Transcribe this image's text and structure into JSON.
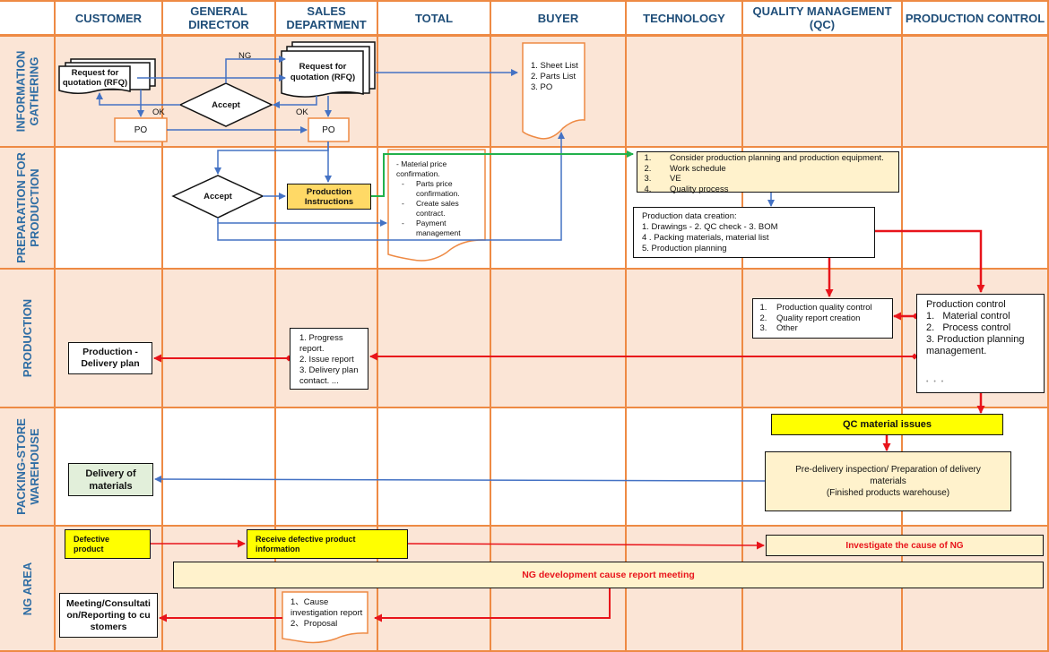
{
  "columns": [
    {
      "id": "customer",
      "label": "CUSTOMER"
    },
    {
      "id": "general-director",
      "label": "GENERAL\nDIRECTOR"
    },
    {
      "id": "sales-department",
      "label": "SALES\nDEPARTMENT"
    },
    {
      "id": "total",
      "label": "TOTAL"
    },
    {
      "id": "buyer",
      "label": "BUYER"
    },
    {
      "id": "technology",
      "label": "TECHNOLOGY"
    },
    {
      "id": "quality-management",
      "label": "QUALITY MANAGEMENT\n(QC)"
    },
    {
      "id": "production-control",
      "label": "PRODUCTION CONTROL"
    }
  ],
  "rows": [
    {
      "id": "information-gathering",
      "label": "INFORMATION\nGATHERING"
    },
    {
      "id": "preparation-for-production",
      "label": "PREPARATION FOR\nPRODUCTION"
    },
    {
      "id": "production",
      "label": "PRODUCTION"
    },
    {
      "id": "packing-store-warehouse",
      "label": "PACKING-STORE\nWAREHOUSE"
    },
    {
      "id": "ng-area",
      "label": "NG AREA"
    }
  ],
  "nodes": {
    "rfq_customer": "Request for quotation (RFQ)",
    "rfq_sales": "Request for quotation (RFQ)",
    "accept_gd": "Accept",
    "po_customer": "PO",
    "po_sales": "PO",
    "label_ng": "NG",
    "label_ok_left": "OK",
    "label_ok_right": "OK",
    "buyer_doc": [
      "1. Sheet List",
      "2. Parts List",
      "3. PO"
    ],
    "accept_prep": "Accept",
    "production_instructions": "Production Instructions",
    "total_doc": {
      "intro": "- Material price confirmation.",
      "items": [
        "Parts price confirmation.",
        "Create sales contract.",
        "Payment management"
      ]
    },
    "tech_plan": [
      "Consider production planning and production equipment.",
      "Work schedule",
      "VE",
      "Quality process"
    ],
    "production_data": [
      "Production data creation:",
      "1. Drawings -  2. QC check -  3. BOM",
      "4 . Packing materials, material list",
      "5. Production planning"
    ],
    "qc_production": [
      "Production quality control",
      "Quality report creation",
      "Other"
    ],
    "production_control": {
      "title": "Production control",
      "items": [
        "1.   Material control",
        "2.   Process control",
        "3. Production planning management."
      ],
      "ellipsis": "• • •"
    },
    "sales_reports": [
      "1. Progress report.",
      "2. Issue report",
      "3. Delivery plan contact. ..."
    ],
    "production_delivery_plan": "Production - Delivery plan",
    "qc_material_issues": "QC material issues",
    "pre_delivery": [
      "Pre-delivery inspection/ Preparation of delivery materials",
      "(Finished products warehouse)"
    ],
    "delivery_of_materials": "Delivery of materials",
    "defective_product": "Defective product",
    "receive_defective": "Receive defective product information",
    "investigate_ng": "Investigate the cause of NG",
    "ng_meeting": "NG development cause report meeting",
    "cause_report": [
      "1、Cause investigation report",
      "2、Proposal"
    ],
    "meeting_customers": "Meeting/Consultation/Reporting to customers"
  },
  "colors": {
    "lane_border": "#ee8a44",
    "lane_shade": "#fbe5d6",
    "header_text": "#1f4e79",
    "blue_flow": "#4472c4",
    "red_flow": "#e8141b",
    "green_flow": "#22b14c",
    "yellow_box": "#ffff00",
    "gold_box": "#ffd966",
    "cream_box": "#fff2cc",
    "green_box": "#e2efda",
    "ng_text": "#e8141b"
  }
}
